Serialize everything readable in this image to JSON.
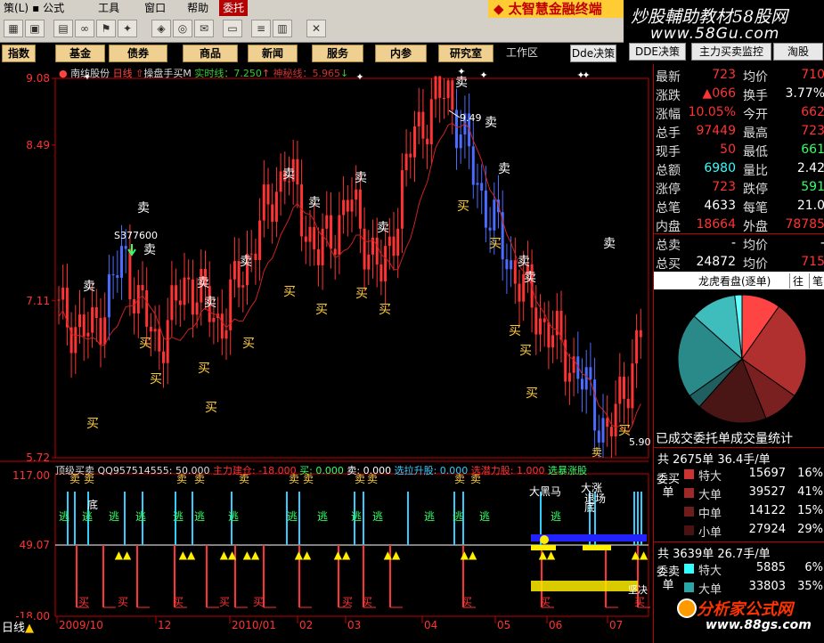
{
  "menu": {
    "items": [
      "策(L)",
      "公式",
      "工具",
      "窗口",
      "帮助",
      "委托"
    ],
    "active_index": 5
  },
  "brand_text": "太智慧金融终端",
  "watermark_top": {
    "line1": "炒股輔助教材58股网",
    "line2": "www.58Gu.com"
  },
  "categories": [
    "指数",
    "基金",
    "债券",
    "商品",
    "新闻",
    "服务",
    "内参",
    "研究室",
    "工作区",
    "Dde决策",
    "DDE决策",
    "主力买卖监控",
    "淘股"
  ],
  "chart_header": {
    "stock_name": "南纺股份",
    "period": "日线",
    "indicator": "操盘手买M",
    "line1": "实时线：7.250",
    "line2": "神秘线：5.965"
  },
  "sub_header": {
    "name": "顶级买卖",
    "qq": "QQ957514555: 50.000",
    "zhuli": "主力建仓: -18.000",
    "buy": "买: 0.000",
    "sell": "卖: 0.000",
    "xuanla": "选拉升股: 0.000",
    "xuanqian": "选潜力股: 1.000",
    "xuanbao": "选暴涨股"
  },
  "price_axis": {
    "labels": [
      "9.08",
      "8.49",
      "7.11",
      "5.72"
    ]
  },
  "sub_axis": {
    "labels": [
      "117.00",
      "49.07",
      "-18.00"
    ]
  },
  "x_axis": {
    "labels": [
      "2009/10",
      "12",
      "2010/01",
      "02",
      "03",
      "04",
      "05",
      "06",
      "07"
    ]
  },
  "period_tab": "日线",
  "annotations": {
    "high": "9.49",
    "low": "5.90",
    "vol": "S377600",
    "sell": "卖",
    "buy": "买",
    "bottom": "底",
    "big_black_horse": "大黑马",
    "big_rise": "大涨",
    "exit": "退场",
    "top": "顶",
    "escape": "逃",
    "harden": "坚决"
  },
  "chart_data": {
    "type": "line",
    "title": "南纺股份 日线",
    "ylim": [
      5.72,
      9.08
    ],
    "x": [
      "2009/10",
      "12",
      "2010/01",
      "02",
      "03",
      "04",
      "05",
      "06",
      "07"
    ],
    "series": [
      {
        "name": "",
        "values": [
          7.0,
          6.8,
          7.5,
          6.7,
          7.3,
          6.9,
          7.6,
          8.3,
          7.5,
          8.0,
          7.3,
          8.6,
          9.0,
          8.1,
          7.4,
          6.9,
          6.5,
          5.9,
          6.8
        ]
      }
    ]
  },
  "quote": {
    "rows": [
      {
        "l1": "最新",
        "v1": "723",
        "l2": "均价",
        "v2": "710"
      },
      {
        "l1": "涨跌",
        "v1": "▲066",
        "l2": "换手",
        "v2": "3.77%"
      },
      {
        "l1": "涨幅",
        "v1": "10.05%",
        "l2": "今开",
        "v2": "662"
      },
      {
        "l1": "总手",
        "v1": "97449",
        "l2": "最高",
        "v2": "723"
      },
      {
        "l1": "现手",
        "v1": "50",
        "l2": "最低",
        "v2": "661"
      },
      {
        "l1": "总额",
        "v1": "6980",
        "l2": "量比",
        "v2": "2.42"
      },
      {
        "l1": "涨停",
        "v1": "723",
        "l2": "跌停",
        "v2": "591"
      },
      {
        "l1": "总笔",
        "v1": "4633",
        "l2": "每笔",
        "v2": "21.0"
      },
      {
        "l1": "内盘",
        "v1": "18664",
        "l2": "外盘",
        "v2": "78785"
      },
      {
        "l1": "总卖",
        "v1": "-",
        "l2": "均价",
        "v2": "-"
      },
      {
        "l1": "总买",
        "v1": "24872",
        "l2": "均价",
        "v2": "715"
      }
    ],
    "colors": {
      "red": "#ff3333",
      "green": "#33ff66",
      "cyan": "#33ffff",
      "white": "#ffffff"
    }
  },
  "lh_bar": {
    "title": "龙虎看盘(逐单)",
    "b1": "往",
    "b2": "笔"
  },
  "stat_title": "已成交委托单成交量统计",
  "buy_stats": {
    "header": "共 2675单 36.4手/单",
    "label": "委买单",
    "rows": [
      {
        "name": "特大",
        "value": "15697",
        "pct": "16%",
        "color": "#cc3333"
      },
      {
        "name": "大单",
        "value": "39527",
        "pct": "41%",
        "color": "#a02828"
      },
      {
        "name": "中单",
        "value": "14122",
        "pct": "15%",
        "color": "#6e1c1c"
      },
      {
        "name": "小单",
        "value": "27924",
        "pct": "29%",
        "color": "#4a1212"
      }
    ]
  },
  "sell_stats": {
    "header": "共 3639单 26.7手/单",
    "label": "委卖单",
    "rows": [
      {
        "name": "特大",
        "value": "5885",
        "pct": "6%",
        "color": "#33ffff"
      },
      {
        "name": "大单",
        "value": "33803",
        "pct": "35%",
        "color": "#2aa6a6"
      }
    ]
  },
  "pie": {
    "slices": [
      {
        "value": 16,
        "color": "#ff4444"
      },
      {
        "value": 41,
        "color": "#b03030"
      },
      {
        "value": 15,
        "color": "#7a2020"
      },
      {
        "value": 29,
        "color": "#4a1515"
      },
      {
        "value": 6,
        "color": "#1f5f5f"
      },
      {
        "value": 35,
        "color": "#2a8a8a"
      },
      {
        "value": 19,
        "color": "#3fbcbc"
      },
      {
        "value": 3,
        "color": "#66ffff"
      }
    ]
  },
  "watermark_bottom": {
    "line1": "分析家公式网",
    "line2": "www.88gs.com"
  }
}
